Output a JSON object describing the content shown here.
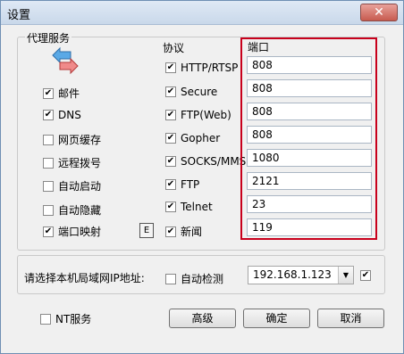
{
  "window": {
    "title": "设置",
    "close": "✕"
  },
  "proxy": {
    "group_title": "代理服务",
    "services": [
      {
        "label": "邮件",
        "checked": true
      },
      {
        "label": "DNS",
        "checked": true
      },
      {
        "label": "网页缓存",
        "checked": false
      },
      {
        "label": "远程拨号",
        "checked": false
      },
      {
        "label": "自动启动",
        "checked": false
      },
      {
        "label": "自动隐藏",
        "checked": false
      },
      {
        "label": "端口映射",
        "checked": true
      }
    ],
    "e_button": "E",
    "protocol_header": "协议",
    "port_header": "端口",
    "protocols": [
      {
        "label": "HTTP/RTSP",
        "checked": true,
        "port": "808"
      },
      {
        "label": "Secure",
        "checked": true,
        "port": "808"
      },
      {
        "label": "FTP(Web)",
        "checked": true,
        "port": "808"
      },
      {
        "label": "Gopher",
        "checked": true,
        "port": "808"
      },
      {
        "label": "SOCKS/MMS",
        "checked": true,
        "port": "1080"
      },
      {
        "label": "FTP",
        "checked": true,
        "port": "2121"
      },
      {
        "label": "Telnet",
        "checked": true,
        "port": "23"
      },
      {
        "label": "新闻",
        "checked": true,
        "port": "119"
      }
    ]
  },
  "lan": {
    "prompt": "请选择本机局域网IP地址:",
    "auto_detect_label": "自动检测",
    "auto_detect_checked": false,
    "ip": "192.168.1.123",
    "confirm_checked": true
  },
  "nt_service": {
    "label": "NT服务",
    "checked": false
  },
  "buttons": {
    "advanced": "高级",
    "ok": "确定",
    "cancel": "取消"
  },
  "check_mark": "✔",
  "colors": {
    "highlight_border": "#c8001c",
    "title_bar": "#c9d8ea",
    "close_button": "#c75b4f"
  },
  "icons": {
    "proxy": "double-arrow-icon"
  }
}
